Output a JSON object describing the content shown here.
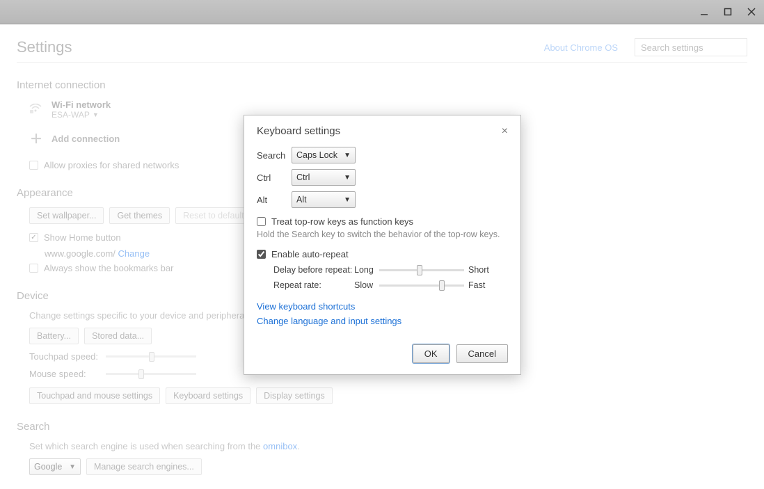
{
  "window": {
    "minimize": "_",
    "maximize": "□",
    "close": "×"
  },
  "header": {
    "title": "Settings",
    "about_link": "About Chrome OS",
    "search_placeholder": "Search settings"
  },
  "internet": {
    "heading": "Internet connection",
    "wifi_label": "Wi-Fi network",
    "wifi_name": "ESA-WAP",
    "add_connection": "Add connection",
    "allow_proxies": "Allow proxies for shared networks"
  },
  "appearance": {
    "heading": "Appearance",
    "set_wallpaper": "Set wallpaper...",
    "get_themes": "Get themes",
    "reset": "Reset to default theme",
    "show_home": "Show Home button",
    "home_url": "www.google.com/",
    "change": "Change",
    "always_bookmarks": "Always show the bookmarks bar"
  },
  "device": {
    "heading": "Device",
    "desc": "Change settings specific to your device and peripherals.",
    "battery": "Battery...",
    "stored_data": "Stored data...",
    "touchpad_speed": "Touchpad speed:",
    "mouse_speed": "Mouse speed:",
    "touchpad_mouse": "Touchpad and mouse settings",
    "keyboard": "Keyboard settings",
    "display": "Display settings"
  },
  "search_section": {
    "heading": "Search",
    "desc_pre": "Set which search engine is used when searching from the ",
    "omnibox": "omnibox",
    "engine": "Google",
    "manage": "Manage search engines..."
  },
  "modal": {
    "title": "Keyboard settings",
    "rows": {
      "search_label": "Search",
      "search_value": "Caps Lock",
      "ctrl_label": "Ctrl",
      "ctrl_value": "Ctrl",
      "alt_label": "Alt",
      "alt_value": "Alt"
    },
    "treat_fn": "Treat top-row keys as function keys",
    "treat_fn_desc": "Hold the Search key to switch the behavior of the top-row keys.",
    "enable_repeat": "Enable auto-repeat",
    "delay_label": "Delay before repeat:",
    "delay_left": "Long",
    "delay_right": "Short",
    "rate_label": "Repeat rate:",
    "rate_left": "Slow",
    "rate_right": "Fast",
    "link_shortcuts": "View keyboard shortcuts",
    "link_language": "Change language and input settings",
    "ok": "OK",
    "cancel": "Cancel"
  }
}
